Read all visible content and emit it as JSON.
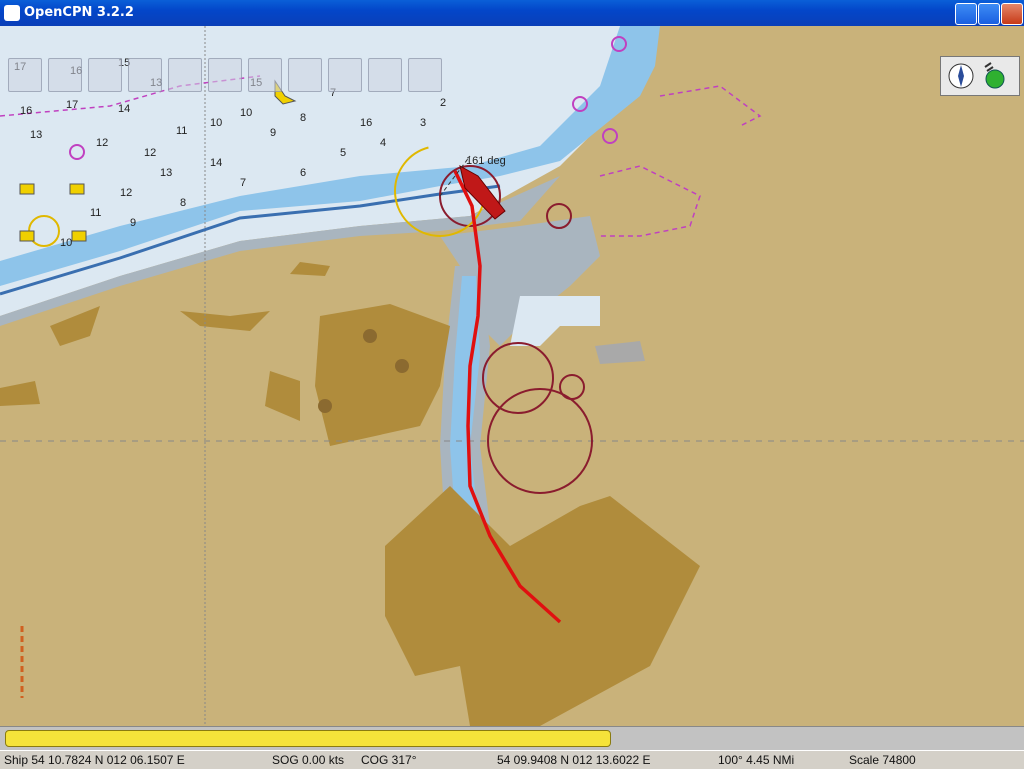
{
  "window": {
    "title": "OpenCPN 3.2.2"
  },
  "toolbar": {
    "buttons": [
      {
        "name": "route-button"
      },
      {
        "name": "ais-target-button"
      },
      {
        "name": "measure-button"
      },
      {
        "name": "zoom-in-button"
      },
      {
        "name": "zoom-out-button"
      },
      {
        "name": "chart-scale-button"
      },
      {
        "name": "settings-button"
      },
      {
        "name": "track-button"
      },
      {
        "name": "color-scheme-button"
      },
      {
        "name": "man-overboard-button"
      },
      {
        "name": "help-button"
      }
    ]
  },
  "chart": {
    "heading_label": "161 deg",
    "soundings": [
      "17",
      "16",
      "15",
      "16",
      "17",
      "14",
      "13",
      "13",
      "12",
      "12",
      "11",
      "10",
      "10",
      "9",
      "8",
      "7",
      "16",
      "15",
      "14",
      "13",
      "12",
      "11",
      "10",
      "9",
      "8",
      "7",
      "6",
      "5",
      "4",
      "3",
      "2"
    ],
    "colors": {
      "land": "#c9b27a",
      "deep_water": "#dce8f2",
      "shallow_water": "#8ec4ea",
      "route": "#e01010",
      "dark_land": "#b08c3c"
    }
  },
  "progress": {
    "fraction": 0.59
  },
  "status": {
    "ship": "Ship 54 10.7824 N   012 06.1507 E",
    "sog": "SOG 0.00 kts",
    "cog": "COG 317°",
    "cursor": "54 09.9408 N   012 13.6022 E",
    "bearing": "100°  4.45 NMi",
    "scale": "Scale 74800"
  }
}
